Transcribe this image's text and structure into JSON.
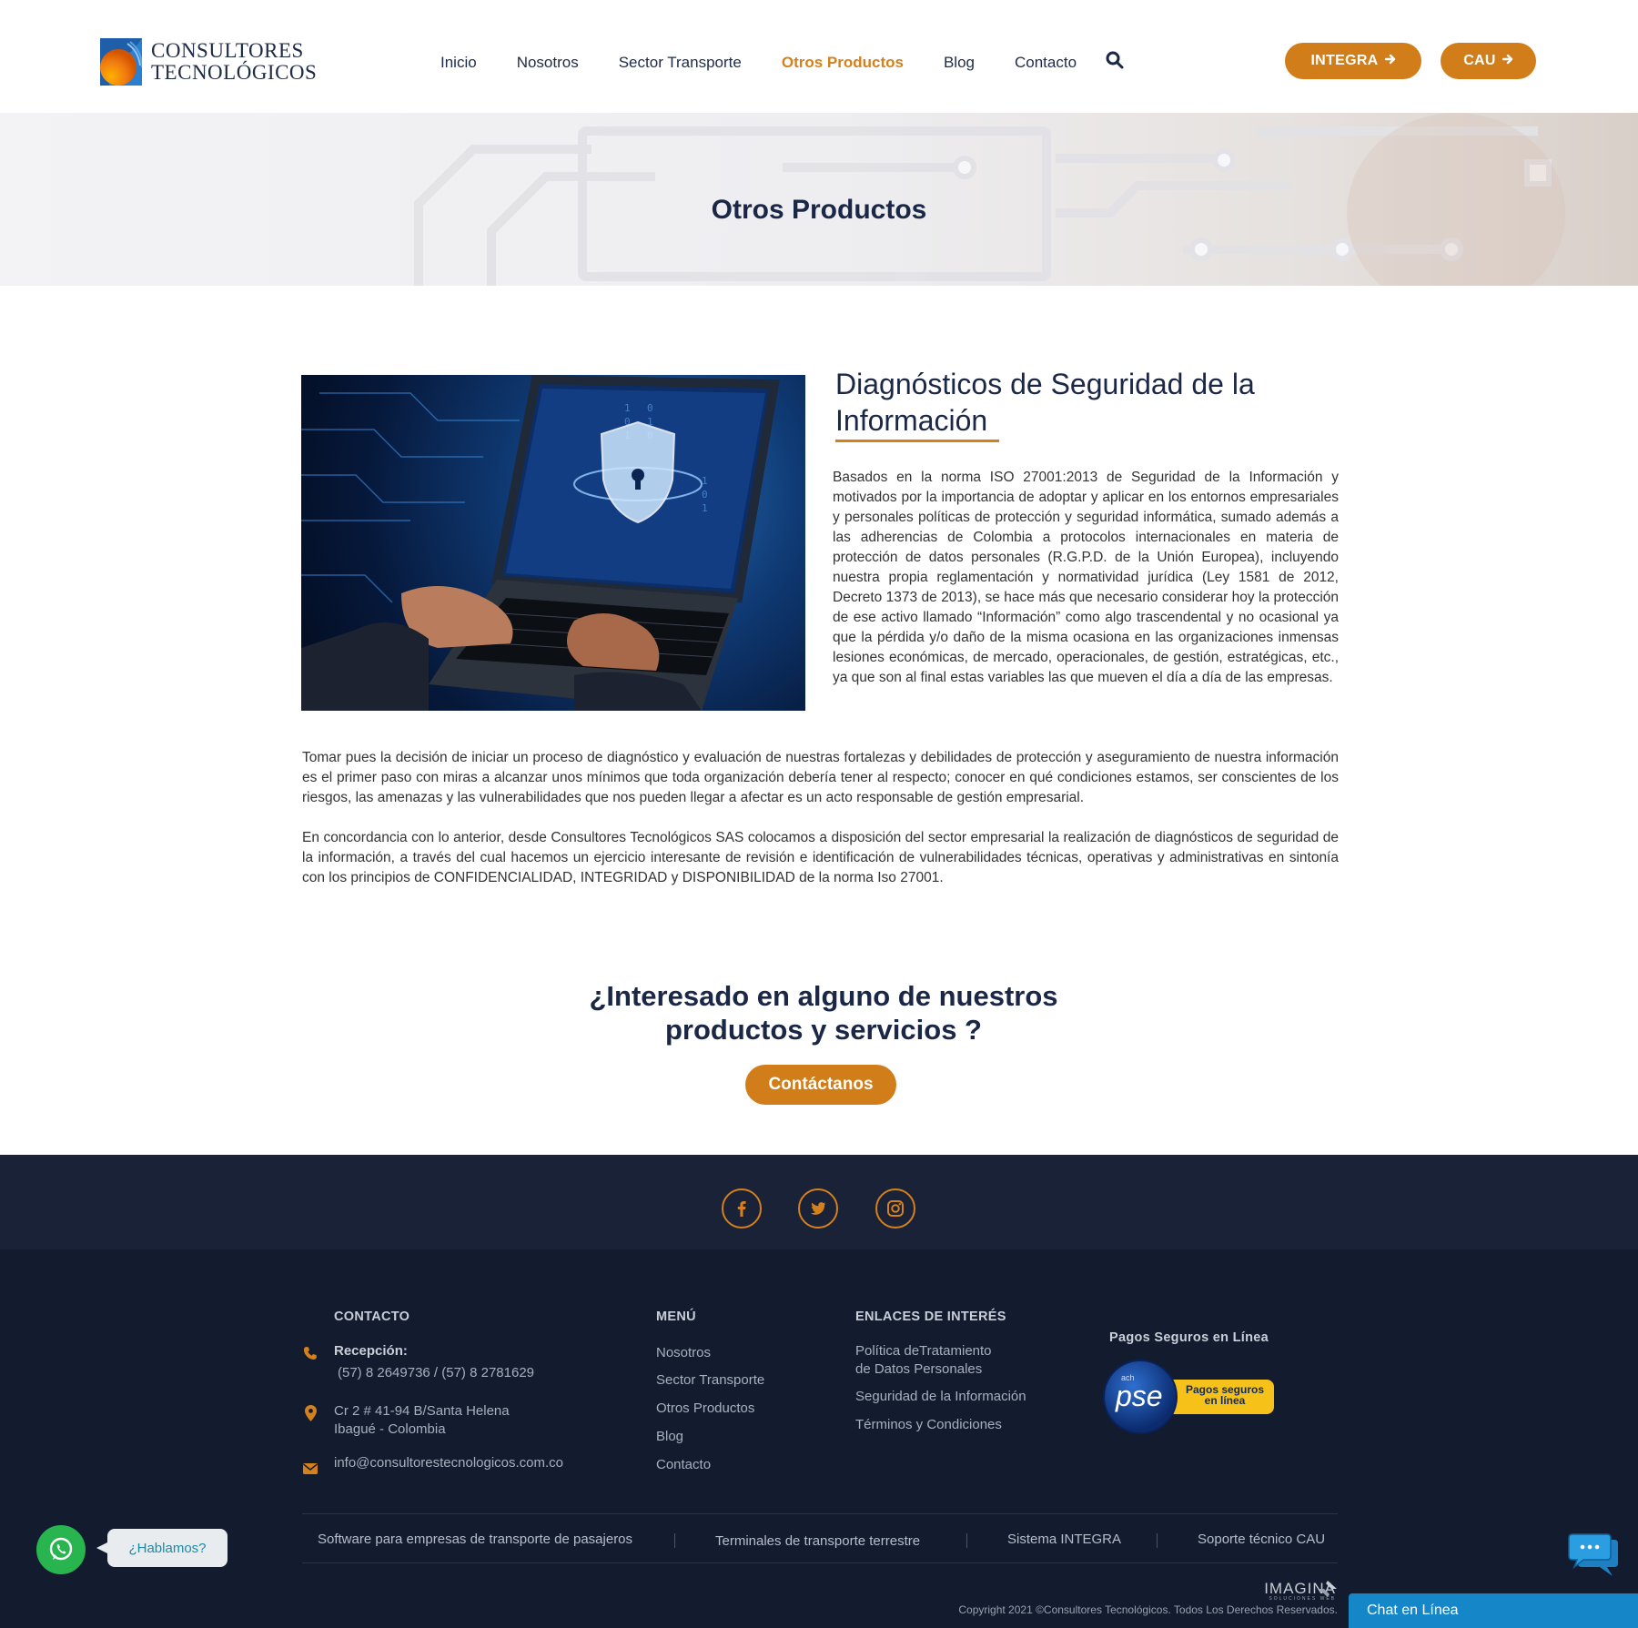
{
  "header": {
    "logo_line1": "CONSULTORES",
    "logo_line2": "TECNOLÓGICOS",
    "nav": [
      {
        "label": "Inicio",
        "active": false
      },
      {
        "label": "Nosotros",
        "active": false
      },
      {
        "label": "Sector Transporte",
        "active": false
      },
      {
        "label": "Otros Productos",
        "active": true
      },
      {
        "label": "Blog",
        "active": false
      },
      {
        "label": "Contacto",
        "active": false
      }
    ],
    "search_icon": "search-icon",
    "btn_integra": "INTEGRA",
    "btn_cau": "CAU",
    "accent_color": "#d17d1a",
    "text_color": "#1b2747"
  },
  "banner": {
    "title": "Otros Productos"
  },
  "content": {
    "title": "Diagnósticos de Seguridad de la Información",
    "image_icon": "laptop-security-shield-image",
    "para1": "Basados en la norma ISO 27001:2013 de Seguridad de la Información y motivados por la importancia de adoptar y aplicar en los entornos empresariales y personales políticas de protección y seguridad informática, sumado además a las adherencias de Colombia a protocolos internacionales en materia de protección de datos personales (R.G.P.D. de la Unión Europea), incluyendo nuestra propia reglamentación y normatividad jurídica (Ley 1581 de 2012, Decreto 1373 de 2013), se hace más que necesario considerar hoy la protección de ese activo llamado “Información” como algo trascendental y no ocasional ya que la pérdida y/o daño de la misma ocasiona en las organizaciones inmensas lesiones económicas, de mercado, operacionales, de gestión, estratégicas, etc.,  ya que son al final estas variables las que mueven el día a día de las empresas.",
    "para2": "Tomar pues la decisión de iniciar un proceso de diagnóstico y evaluación de nuestras fortalezas y debilidades de protección y aseguramiento de nuestra información es el primer paso con miras a alcanzar unos mínimos que toda organización debería tener al respecto; conocer en qué condiciones estamos, ser conscientes de los riesgos, las amenazas y las vulnerabilidades que nos pueden llegar a afectar es un acto responsable de gestión empresarial.",
    "para3": "En concordancia con lo anterior, desde Consultores Tecnológicos SAS colocamos a disposición del sector empresarial la realización de diagnósticos de seguridad de la información, a través del cual hacemos un ejercicio interesante de revisión e identificación de vulnerabilidades técnicas, operativas y administrativas en sintonía con los principios de CONFIDENCIALIDAD, INTEGRIDAD y DISPONIBILIDAD de la norma Iso 27001."
  },
  "cta": {
    "line1": "¿Interesado en alguno de nuestros",
    "line2": "productos y servicios ?",
    "button": "Contáctanos"
  },
  "social": [
    "facebook-icon",
    "twitter-icon",
    "instagram-icon"
  ],
  "footer": {
    "contact": {
      "heading": "CONTACTO",
      "reception_label": "Recepción:",
      "phones": "(57) 8 2649736 / (57) 8 2781629",
      "address1": "Cr 2 # 41-94 B/Santa Helena",
      "address2": "Ibagué - Colombia",
      "email": "info@consultorestecnologicos.com.co"
    },
    "menu": {
      "heading": "MENÚ",
      "items": [
        "Nosotros",
        "Sector Transporte",
        "Otros Productos",
        "Blog",
        "Contacto"
      ]
    },
    "links": {
      "heading": "ENLACES DE INTERÉS",
      "item1_line1": "Política deTratamiento",
      "item1_line2": "de Datos Personales",
      "item2": "Seguridad de la Información",
      "item3": "Términos y Condiciones"
    },
    "payments": {
      "heading": "Pagos Seguros en Línea",
      "pse_brand": "pse",
      "pse_small": "ach",
      "pse_tag_line1": "Pagos seguros",
      "pse_tag_line2": "en línea"
    },
    "bottom_links": [
      "Software para empresas de transporte de pasajeros",
      "Terminales de transporte terrestre",
      "Sistema INTEGRA",
      "Soporte técnico CAU"
    ],
    "imagina_logo": "IMAGINA",
    "imagina_sub": "SOLUCIONES WEB",
    "copyright": "Copyright 2021 ©Consultores Tecnológicos. Todos Los Derechos Reservados."
  },
  "widgets": {
    "whatsapp_bubble": "¿Hablamos?",
    "chat_label": "Chat en Línea"
  }
}
